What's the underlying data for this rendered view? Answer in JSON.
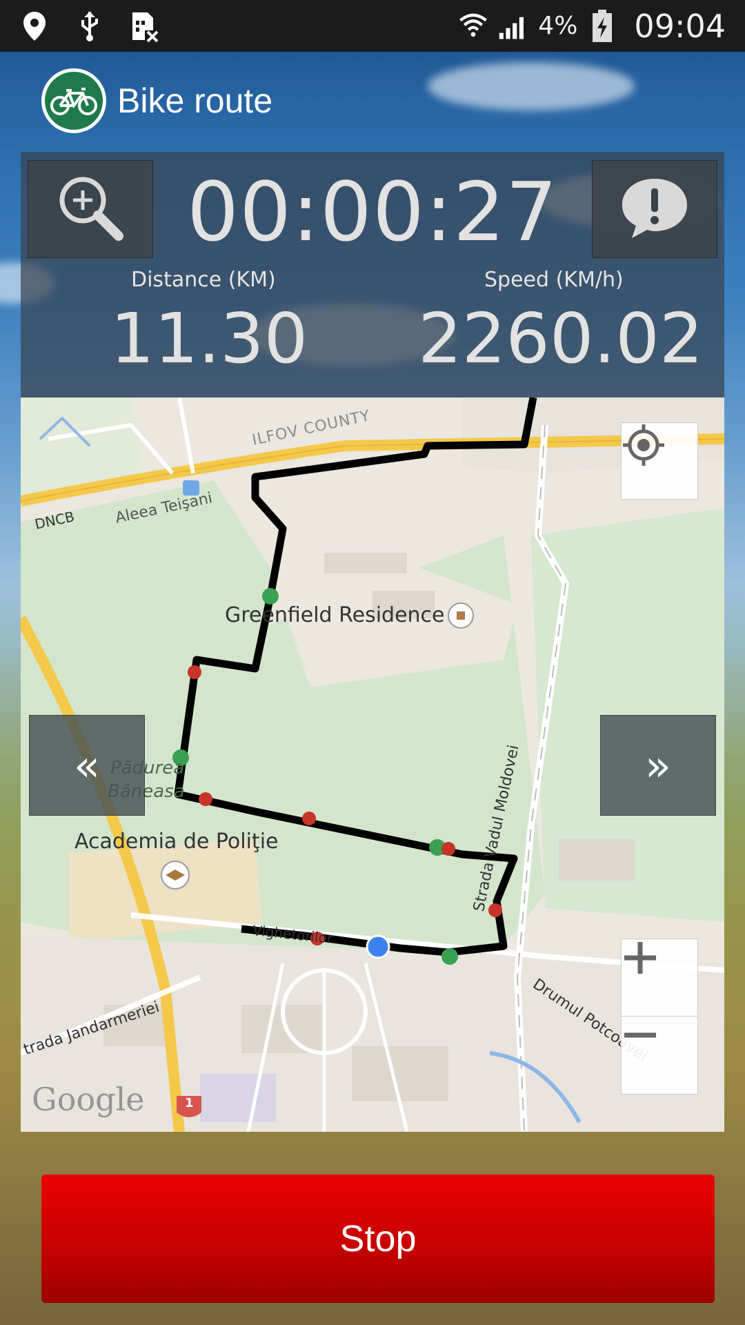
{
  "status_bar": {
    "battery_percent": "4%",
    "time": "09:04",
    "icons": [
      "location-icon",
      "usb-icon",
      "sim-blocked-icon",
      "wifi-icon",
      "signal-icon",
      "battery-charging-icon"
    ]
  },
  "app_bar": {
    "title": "Bike route",
    "logo_icon": "bicycle-icon"
  },
  "stats": {
    "timer": "00:00:27",
    "distance_label": "Distance (KM)",
    "distance_value": "11.30",
    "speed_label": "Speed (KM/h)",
    "speed_value": "2260.02"
  },
  "map": {
    "labels": {
      "county": "ILFOV COUNTY",
      "dncb": "DNCB",
      "aleea": "Aleea Teişani",
      "greenfield": "Greenfield Residence",
      "padurea_line1": "Pădurea",
      "padurea_line2": "Băneasa",
      "academia": "Academia de Poliţie",
      "vadul": "Strada Vadul Moldovei",
      "vighetorilor": "Vighetorilor",
      "jandarmeriei": "trada Jandarmeriei",
      "potcoavei": "Drumul Potcoavei",
      "route_shield": "1",
      "google": "Google"
    },
    "prev_label": "«",
    "next_label": "»",
    "zoom_in_label": "+",
    "zoom_out_label": "−"
  },
  "actions": {
    "stop_label": "Stop"
  },
  "colors": {
    "route": "#000000",
    "marker_green": "#3aa052",
    "marker_red": "#c8342a",
    "current_position": "#3b82f0",
    "stop_button": "#d40000"
  }
}
